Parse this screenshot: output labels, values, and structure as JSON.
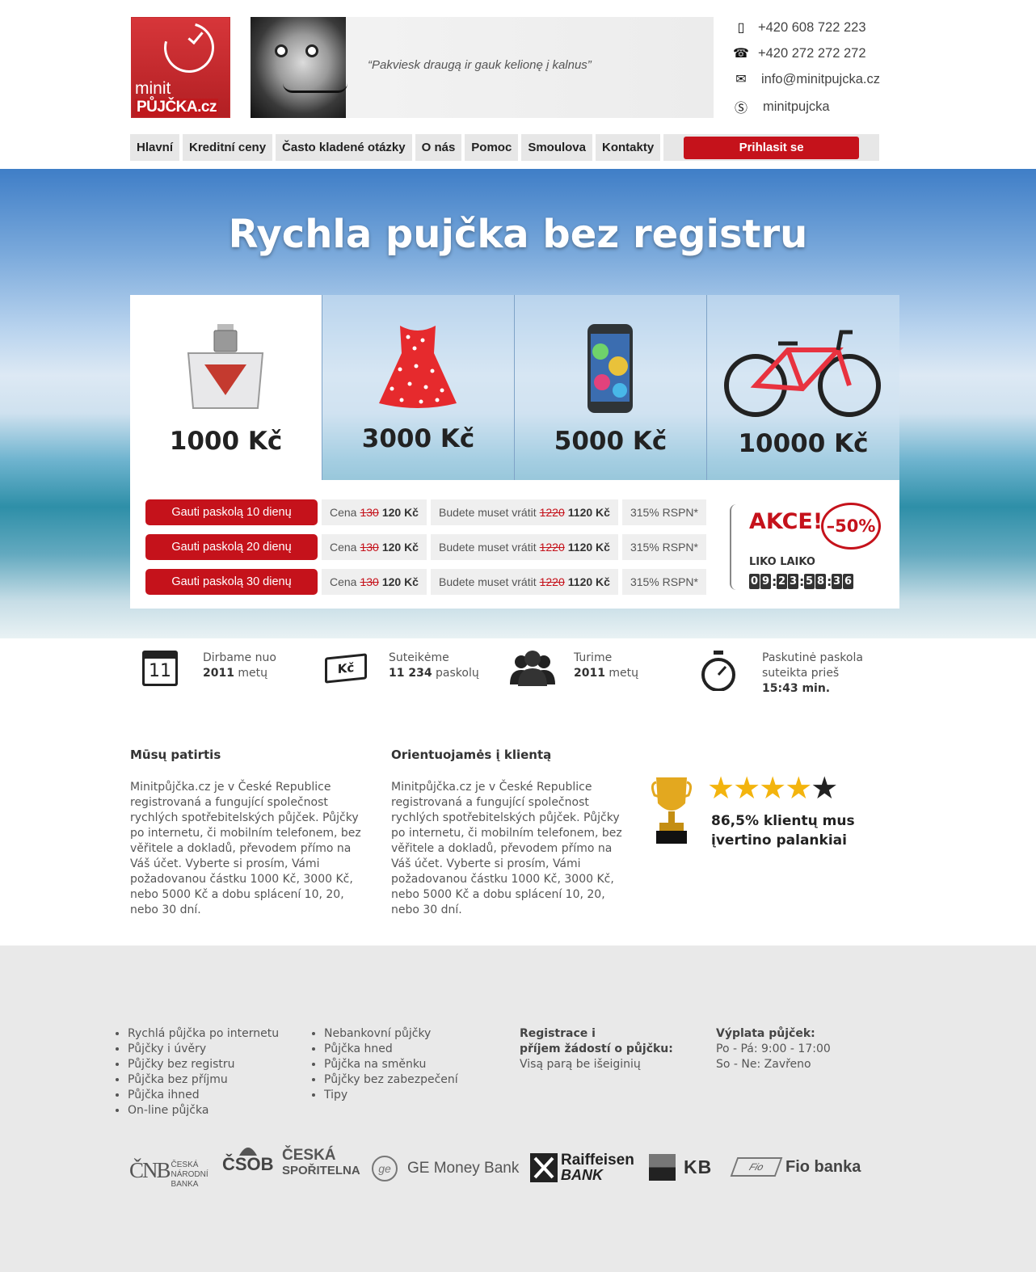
{
  "header": {
    "logo_line1": "minit",
    "logo_line2": "PŮJČKA.cz",
    "quote": "“Pakviesk draugą ir gauk kelionę į kalnus”",
    "contacts": [
      {
        "icon": "mobile-phone-icon",
        "text": "+420 608 722 223"
      },
      {
        "icon": "phone-icon",
        "text": "+420 272 272 272"
      },
      {
        "icon": "envelope-icon",
        "text": "info@minitpujcka.cz"
      },
      {
        "icon": "skype-icon",
        "text": "minitpujcka"
      }
    ]
  },
  "nav": {
    "items": [
      "Hlavní",
      "Kreditní ceny",
      "Často kladené otázky",
      "O nás",
      "Pomoc",
      "Smoulova",
      "Kontakty"
    ],
    "login": "Prihlasit se"
  },
  "hero": {
    "title": "Rychla pujčka bez registru",
    "products": [
      {
        "icon": "perfume-icon",
        "price": "1000 Kč"
      },
      {
        "icon": "dress-icon",
        "price": "3000 Kč"
      },
      {
        "icon": "smartphone-icon",
        "price": "5000 Kč"
      },
      {
        "icon": "bicycle-icon",
        "price": "10000 Kč"
      }
    ],
    "offers": [
      {
        "button": "Gauti paskolą 10 dienų",
        "cena_label": "Cena",
        "cena_old": "130",
        "cena_new": "120 Kč",
        "return_label": "Budete muset vrátit",
        "return_old": "1220",
        "return_new": "1120 Kč",
        "rpsn": "315% RSPN*"
      },
      {
        "button": "Gauti paskolą 20 dienų",
        "cena_label": "Cena",
        "cena_old": "130",
        "cena_new": "120 Kč",
        "return_label": "Budete muset vrátit",
        "return_old": "1220",
        "return_new": "1120 Kč",
        "rpsn": "315% RSPN*"
      },
      {
        "button": "Gauti paskolą 30 dienų",
        "cena_label": "Cena",
        "cena_old": "130",
        "cena_new": "120 Kč",
        "return_label": "Budete muset vrátit",
        "return_old": "1220",
        "return_new": "1120 Kč",
        "rpsn": "315% RSPN*"
      }
    ],
    "akce": "AKCE!",
    "discount": "–50%",
    "liko_laiko": "LIKO LAIKO",
    "timer": [
      "0",
      "9",
      ":",
      "2",
      "3",
      ":",
      "5",
      "8",
      ":",
      "3",
      "6"
    ]
  },
  "stats": [
    {
      "icon": "calendar-icon",
      "icon_text": "11",
      "line1": "Dirbame nuo",
      "bold": "2011",
      "rest": " metų"
    },
    {
      "icon": "banknote-icon",
      "icon_text": "Kč",
      "line1": "Suteikėme",
      "bold": "11 234",
      "rest": " paskolų"
    },
    {
      "icon": "people-icon",
      "icon_text": "",
      "line1": "Turime",
      "bold": "2011",
      "rest": " metų"
    },
    {
      "icon": "stopwatch-icon",
      "icon_text": "",
      "line1": "Paskutinė paskola",
      "line2": "suteikta prieš",
      "bold": "15:43 min.",
      "rest": ""
    }
  ],
  "about": {
    "col1_title": "Mūsų patirtis",
    "col1_text": "Minitpůjčka.cz je v České Republice registrovaná a fungující společnost rychlých spotřebitelských půjček. Půjčky po internetu, či mobilním telefonem, bez věřitele a dokladů, převodem přímo na Váš účet. Vyberte si prosím, Vámi požadovanou částku 1000 Kč, 3000 Kč, nebo 5000 Kč  a dobu splácení 10, 20, nebo 30 dní.",
    "col2_title": "Orientuojamės į klientą",
    "col2_text": "Minitpůjčka.cz je v České Republice registrovaná a fungující společnost rychlých spotřebitelských půjček. Půjčky po internetu, či mobilním telefonem, bez věřitele a dokladů, převodem přímo na Váš účet. Vyberte si prosím, Vámi požadovanou částku 1000 Kč, 3000 Kč, nebo 5000 Kč  a dobu splácení 10, 20, nebo 30 dní.",
    "rating_line1": "86,5% klientų mus",
    "rating_line2": "įvertino palankiai",
    "stars": "★★★★",
    "half_star": "★"
  },
  "footer": {
    "links1": [
      "Rychlá půjčka po internetu",
      "Půjčky i úvěry",
      "Půjčky bez registru",
      "Půjčka bez příjmu",
      "Půjčka ihned",
      "On-line půjčka"
    ],
    "links2": [
      "Nebankovní půjčky",
      "Půjčka hned",
      "Půjčka na směnku",
      "Půjčky bez zabezpečení",
      "Tipy"
    ],
    "reg_title1": "Registrace i",
    "reg_title2": "příjem žádostí o půjčku:",
    "reg_text": "Visą parą be išeiginių",
    "pay_title": "Výplata půjček:",
    "pay_line1": "Po - Pá: 9:00 - 17:00",
    "pay_line2": "So - Ne: Zavřeno",
    "banks": [
      "ČNB",
      "ČESKÁ NÁRODNÍ BANKA",
      "ČSOB",
      "ČESKÁ",
      "SPOŘITELNA",
      "GE Money Bank",
      "Raiffeisen",
      "BANK",
      "KB",
      "Fio banka"
    ]
  }
}
